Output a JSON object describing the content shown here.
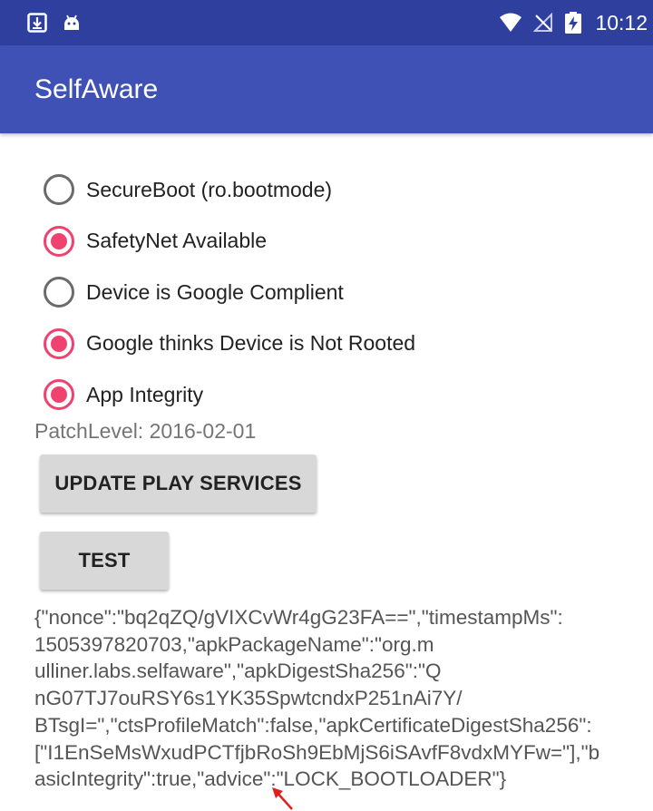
{
  "status_bar": {
    "time": "10:12",
    "left_icons": [
      "download-icon",
      "android-icon"
    ],
    "right_icons": [
      "wifi-icon",
      "no-sim-icon",
      "battery-charging-icon"
    ]
  },
  "app_bar": {
    "title": "SelfAware"
  },
  "checks": [
    {
      "label": "SecureBoot (ro.bootmode)",
      "checked": false
    },
    {
      "label": "SafetyNet Available",
      "checked": true
    },
    {
      "label": "Device is Google Complient",
      "checked": false
    },
    {
      "label": "Google thinks Device is Not Rooted",
      "checked": true
    },
    {
      "label": "App Integrity",
      "checked": true
    }
  ],
  "patch_level": "PatchLevel: 2016-02-01",
  "buttons": {
    "update_play_services": "UPDATE PLAY SERVICES",
    "test": "TEST"
  },
  "result_json": "{\"nonce\":\"bq2qZQ/gVIXCvWr4gG23FA==\",\"timestampMs\":\n1505397820703,\"apkPackageName\":\"org.m\nulliner.labs.selfaware\",\"apkDigestSha256\":\"Q\nnG07TJ7ouRSY6s1YK35SpwtcndxP251nAi7Y/\nBTsgI=\",\"ctsProfileMatch\":false,\"apkCertificateDigestSha256\":\n[\"I1EnSeMsWxudPCTfjbRoSh9EbMjS6iSAvfF8vdxMYFw=\"],\"b\nasicIntegrity\":true,\"advice\":\"LOCK_BOOTLOADER\"}",
  "colors": {
    "status_bar": "#2f3f9e",
    "app_bar": "#3f51b5",
    "accent": "#f0426f",
    "annotation": "#e0201c"
  }
}
